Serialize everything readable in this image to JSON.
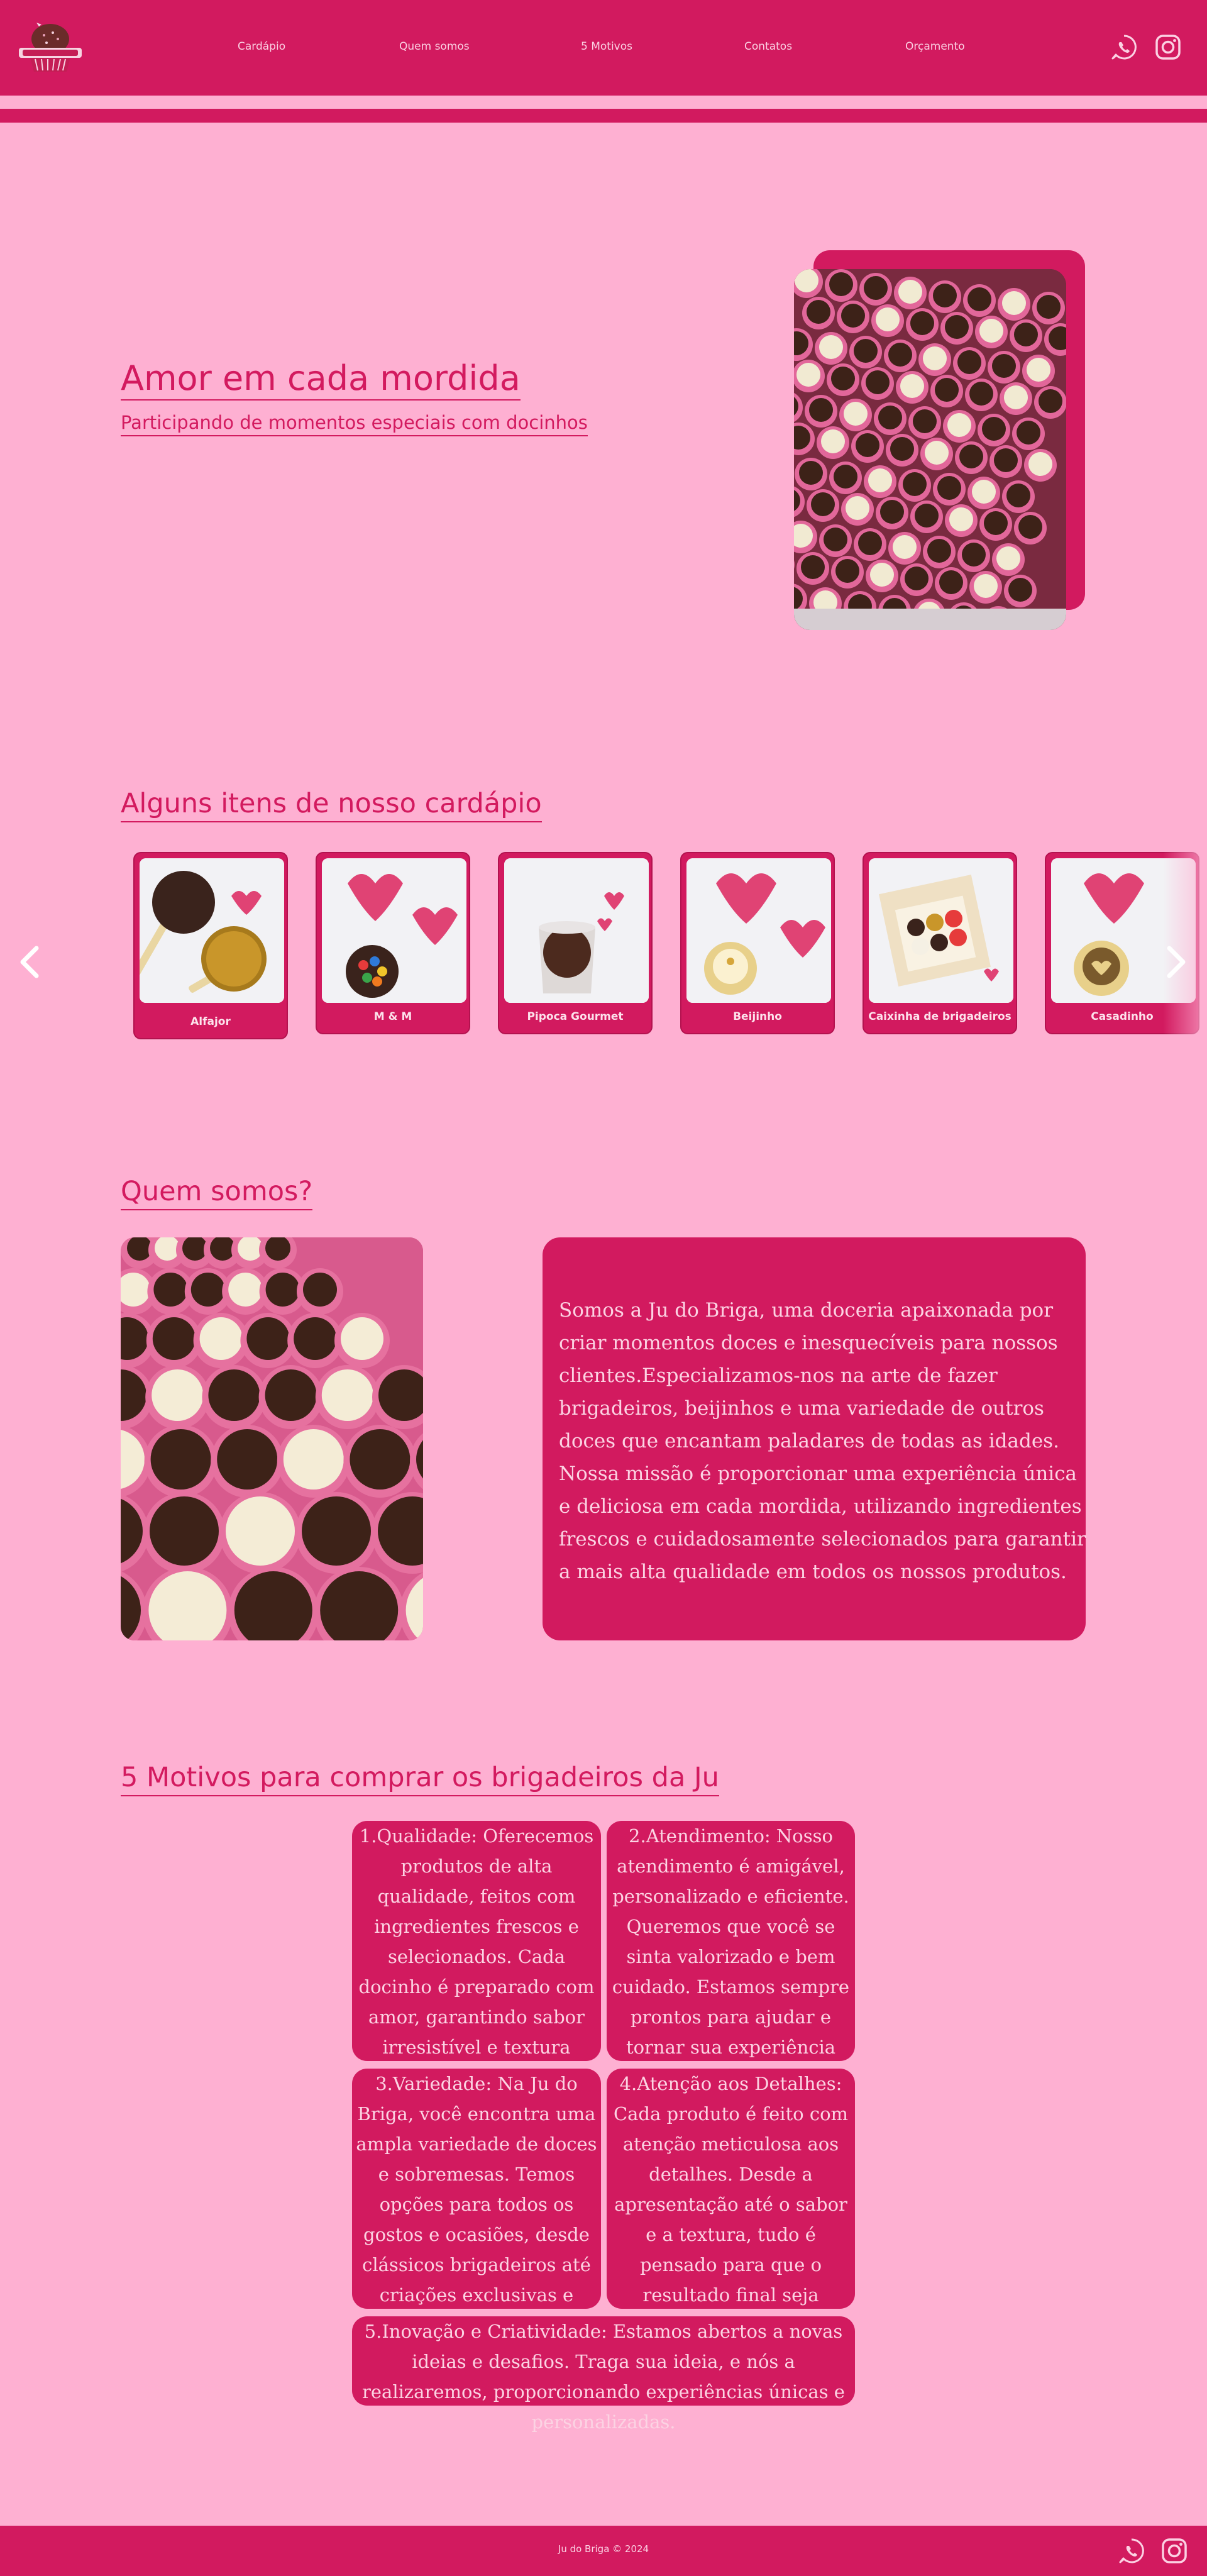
{
  "brand": {
    "logo_icon": "brigadeiro-logo-icon",
    "colors": {
      "primary": "#d21a5f",
      "background": "#feb0d2",
      "text_light": "#fcd3e3"
    }
  },
  "nav": {
    "items": [
      "Cardápio",
      "Quem somos",
      "5 Motivos",
      "Contatos",
      "Orçamento"
    ]
  },
  "social": {
    "whatsapp_icon": "whatsapp-icon",
    "instagram_icon": "instagram-icon"
  },
  "hero": {
    "title": "Amor em cada mordida",
    "subtitle": "Participando de momentos especiais com docinhos"
  },
  "menu": {
    "title": "Alguns itens de nosso cardápio",
    "items": [
      "Alfajor",
      "M & M",
      "Pipoca Gourmet",
      "Beijinho",
      "Caixinha de brigadeiros",
      "Casadinho"
    ]
  },
  "about": {
    "title": "Quem somos?",
    "text": "Somos a Ju do Briga, uma doceria apaixonada por criar momentos doces e inesquecíveis para nossos clientes.Especializamos-nos na arte de fazer brigadeiros, beijinhos e uma variedade de outros doces que encantam paladares de todas as idades. Nossa missão é proporcionar uma experiência única e deliciosa em cada mordida, utilizando ingredientes frescos e cuidadosamente selecionados para garantir a mais alta qualidade em todos os nossos produtos."
  },
  "reasons": {
    "title": "5 Motivos para comprar os brigadeiros da Ju",
    "items": [
      "1.Qualidade: Oferecemos produtos de alta qualidade, feitos com ingredientes frescos e selecionados. Cada docinho é preparado com amor, garantindo sabor irresistível e textura perfeita.",
      "2.Atendimento: Nosso atendimento é amigável, personalizado e eficiente. Queremos que você se sinta valorizado e bem cuidado. Estamos sempre prontos para ajudar e tornar sua experiência agradável.",
      "3.Variedade: Na Ju do Briga, você encontra uma ampla variedade de doces e sobremesas. Temos opções para todos os gostos e ocasiões, desde clássicos brigadeiros até criações exclusivas e inovadoras.",
      "4.Atenção aos Detalhes: Cada produto é feito com atenção meticulosa aos detalhes. Desde a apresentação até o sabor e a textura, tudo é pensado para que o resultado final seja perfeito.",
      "5.Inovação e Criatividade: Estamos abertos a novas ideias e desafios. Traga sua ideia, e nós a realizaremos, proporcionando experiências únicas e personalizadas."
    ]
  },
  "footer": {
    "text": "Ju do Briga © 2024"
  }
}
